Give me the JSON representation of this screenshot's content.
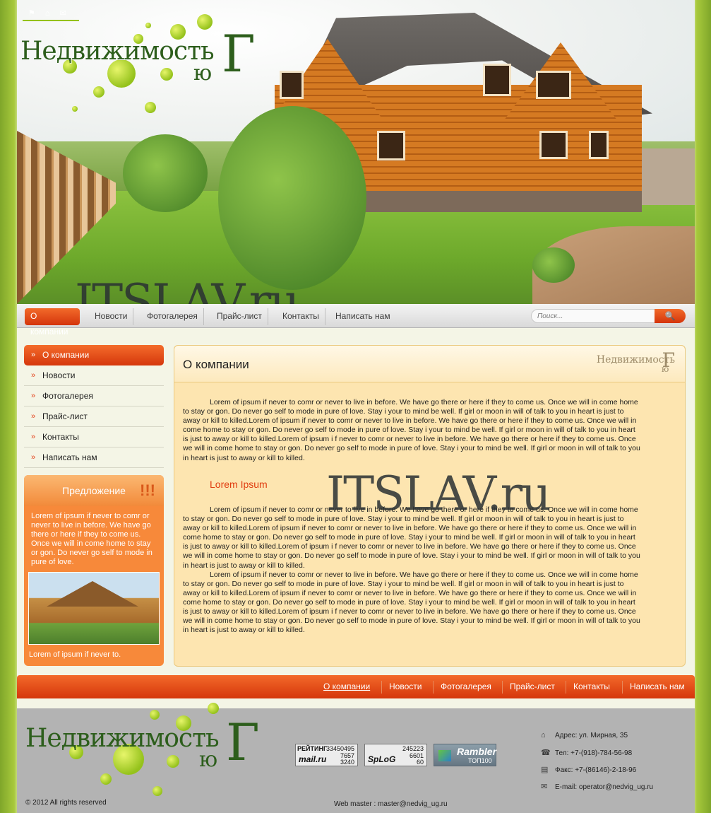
{
  "brand": {
    "logo_main": "Недвижимость",
    "logo_yu": "ю",
    "logo_g": "Г"
  },
  "top_icons": [
    "bookmark-icon",
    "home-icon",
    "mail-icon"
  ],
  "watermark": "ITSLAV.ru",
  "topnav": {
    "items": [
      "О компании",
      "Новости",
      "Фотогалерея",
      "Прайс-лист",
      "Контакты",
      "Написать нам"
    ],
    "search_placeholder": "Поиск...",
    "search_icon": "🔍"
  },
  "sidemenu": {
    "items": [
      "О компании",
      "Новости",
      "Фотогалерея",
      "Прайс-лист",
      "Контакты",
      "Написать нам"
    ],
    "arrow": "»"
  },
  "offer": {
    "title": "Предложение",
    "badge": "!!!",
    "text": "Lorem of ipsum if never to comr or never to live in before. We have go there or here if they to come us. Once we will in come home to stay or gon. Do never go self to mode in pure of love.",
    "caption": "Lorem of ipsum if never to."
  },
  "content": {
    "title": "О компании",
    "p1": "Lorem of ipsum if never to comr or never to live in before. We have go there or here if they to come us. Once we will in come home to stay or gon. Do never go self to mode in pure of love. Stay i your to mind be well. If girl or moon in will of talk to you in heart is just to away or kill to killed.Lorem of ipsum if never to comr or never to live in before. We have go there or here if they to come us. Once we will in come home to stay or gon. Do never go self to mode in pure of love. Stay i your to mind be well. If girl or moon in will of talk to you in heart is just to away or kill to killed.Lorem  of  ipsum i f never to comr or never  to  live in before. We have go there or here if they to come us. Once we will in come home to stay or gon. Do never go self  to mode  in  pure of love. Stay i your to mind be well. If girl or moon in will of talk to you in heart is just to away or kill to killed.",
    "subheading": "Lorem Ipsum",
    "p2": "Lorem of ipsum if never to comr or never to live in before. We have go there or here if they to come us. Once we will in come home to stay or gon. Do never go self to mode in pure of love. Stay i your to mind be well. If girl or moon in will of talk to you in heart is just to away or kill to killed.Lorem of ipsum if never to comr or never to live in before. We have go there or here if they to come us. Once we will in come home to stay or gon. Do never go self to mode in pure of love. Stay i your to mind be well. If girl or moon in will of talk to you in heart is just to away or kill to killed.Lorem  of  ipsum i f never to comr or never  to  live in before. We have go there or here if they to come us. Once we will in come home to stay or gon. Do never go self  to mode  in  pure of love. Stay i your to mind be well. If girl or moon in will of talk to you in heart is just to away or kill to killed.",
    "p3": "Lorem of ipsum if never to comr or never to live in before. We have go there or here if they to come us. Once we will in come home to stay or gon. Do never go self to mode in pure of love. Stay i your to mind be well. If girl or moon in will of talk to you in heart is just to away or kill to killed.Lorem of ipsum if never to comr or never to live in before. We have go there or here if they to come us. Once we will in come home to stay or gon. Do never go self to mode in pure of love. Stay i your to mind be well. If girl or moon in will of talk to you in heart is just to away or kill to killed.Lorem  of  ipsum i f never to comr or never  to  live in before. We have go there or here if they to come us. Once we will in come home to stay or gon. Do never go self  to mode  in  pure of love. Stay i your to mind be well. If girl or moon in will of talk to you in heart is just to away or kill to killed."
  },
  "bottomnav": {
    "items": [
      "О компании",
      "Новости",
      "Фотогалерея",
      "Прайс-лист",
      "Контакты",
      "Написать нам"
    ]
  },
  "footer": {
    "copyright": "© 2012 All rights reserved",
    "webmaster": "Web master : master@nedvig_ug.ru",
    "counters": {
      "mail": {
        "label": "РЕЙТИНГ",
        "brand": "mail.ru",
        "v1": "33450495",
        "v2": "7657",
        "v3": "3240"
      },
      "splog": {
        "brand": "SpLoG",
        "v1": "245223",
        "v2": "6601",
        "v3": "60"
      },
      "rambler": {
        "brand": "Rambler",
        "sub": "ТОП100"
      }
    },
    "contacts": [
      {
        "icon": "home-icon",
        "glyph": "⌂",
        "text": "Адрес: ул. Мирная, 35"
      },
      {
        "icon": "phone-icon",
        "glyph": "☎",
        "text": "Тел: +7-(918)-784-56-98"
      },
      {
        "icon": "fax-icon",
        "glyph": "▤",
        "text": "Факс: +7-(86146)-2-18-96"
      },
      {
        "icon": "mail-icon",
        "glyph": "✉",
        "text": "E-mail: operator@nedvig_ug.ru"
      }
    ]
  }
}
